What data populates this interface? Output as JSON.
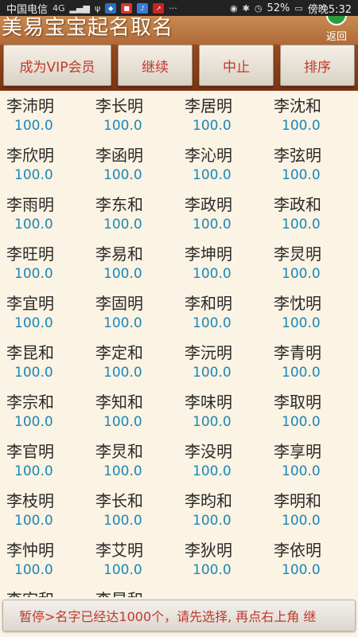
{
  "status_bar": {
    "carrier": "中国电信",
    "network": "4G",
    "battery": "52%",
    "time": "傍晚5:32"
  },
  "header": {
    "title": "美易宝宝起名取名",
    "back_label": "返回"
  },
  "toolbar": {
    "vip": "成为VIP会员",
    "continue": "继续",
    "stop": "中止",
    "sort": "排序"
  },
  "names": [
    {
      "name": "李沛明",
      "score": "100.0"
    },
    {
      "name": "李长明",
      "score": "100.0"
    },
    {
      "name": "李居明",
      "score": "100.0"
    },
    {
      "name": "李沈和",
      "score": "100.0"
    },
    {
      "name": "李欣明",
      "score": "100.0"
    },
    {
      "name": "李函明",
      "score": "100.0"
    },
    {
      "name": "李沁明",
      "score": "100.0"
    },
    {
      "name": "李弦明",
      "score": "100.0"
    },
    {
      "name": "李雨明",
      "score": "100.0"
    },
    {
      "name": "李东和",
      "score": "100.0"
    },
    {
      "name": "李政明",
      "score": "100.0"
    },
    {
      "name": "李政和",
      "score": "100.0"
    },
    {
      "name": "李旺明",
      "score": "100.0"
    },
    {
      "name": "李易和",
      "score": "100.0"
    },
    {
      "name": "李坤明",
      "score": "100.0"
    },
    {
      "name": "李炅明",
      "score": "100.0"
    },
    {
      "name": "李宜明",
      "score": "100.0"
    },
    {
      "name": "李固明",
      "score": "100.0"
    },
    {
      "name": "李和明",
      "score": "100.0"
    },
    {
      "name": "李忱明",
      "score": "100.0"
    },
    {
      "name": "李昆和",
      "score": "100.0"
    },
    {
      "name": "李定和",
      "score": "100.0"
    },
    {
      "name": "李沅明",
      "score": "100.0"
    },
    {
      "name": "李青明",
      "score": "100.0"
    },
    {
      "name": "李宗和",
      "score": "100.0"
    },
    {
      "name": "李知和",
      "score": "100.0"
    },
    {
      "name": "李味明",
      "score": "100.0"
    },
    {
      "name": "李取明",
      "score": "100.0"
    },
    {
      "name": "李官明",
      "score": "100.0"
    },
    {
      "name": "李炅和",
      "score": "100.0"
    },
    {
      "name": "李没明",
      "score": "100.0"
    },
    {
      "name": "李享明",
      "score": "100.0"
    },
    {
      "name": "李枝明",
      "score": "100.0"
    },
    {
      "name": "李长和",
      "score": "100.0"
    },
    {
      "name": "李昀和",
      "score": "100.0"
    },
    {
      "name": "李明和",
      "score": "100.0"
    },
    {
      "name": "李忡明",
      "score": "100.0"
    },
    {
      "name": "李艾明",
      "score": "100.0"
    },
    {
      "name": "李狄明",
      "score": "100.0"
    },
    {
      "name": "李依明",
      "score": "100.0"
    },
    {
      "name": "李宏和",
      "score": ""
    },
    {
      "name": "李昇和",
      "score": ""
    }
  ],
  "notice": "暂停>名字已经达1000个，请先选择, 再点右上角  继",
  "colors": {
    "header": "#b06a38",
    "toolbar": "#7b3412",
    "button_text": "#c0392b",
    "score": "#1a87b8",
    "background": "#fbf3e3"
  }
}
